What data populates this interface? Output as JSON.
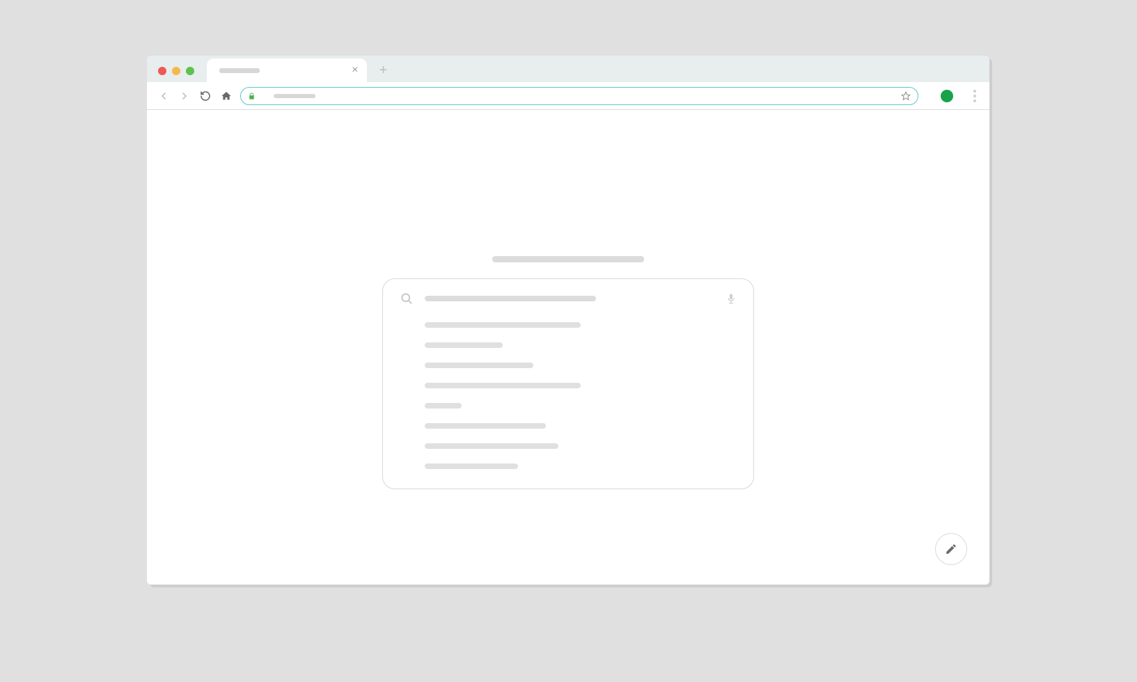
{
  "window": {
    "controls": {
      "close": "close",
      "minimize": "minimize",
      "maximize": "maximize"
    }
  },
  "tabs": {
    "active_title": "",
    "close_glyph": "×",
    "new_tab_glyph": "+"
  },
  "toolbar": {
    "address_value": "",
    "address_placeholder": ""
  },
  "colors": {
    "accent": "#5fc6c8",
    "avatar": "#17a34a",
    "lock": "#4caf50"
  },
  "search": {
    "query": "",
    "suggestion_widths_pct": [
      50,
      25,
      35,
      50,
      12,
      39,
      43,
      30
    ]
  }
}
